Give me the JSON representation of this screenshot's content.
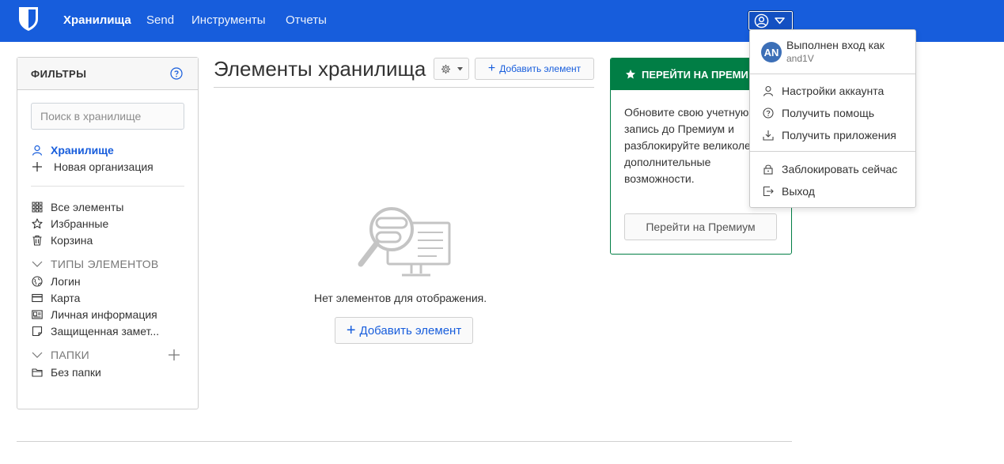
{
  "nav": {
    "links": [
      "Хранилища",
      "Send",
      "Инструменты",
      "Отчеты"
    ]
  },
  "filters": {
    "title": "ФИЛЬТРЫ",
    "search_placeholder": "Поиск в хранилище",
    "vault_label": "Хранилище",
    "new_org_label": "Новая организация",
    "all_items": "Все элементы",
    "favorites": "Избранные",
    "trash": "Корзина",
    "types_header": "ТИПЫ ЭЛЕМЕНТОВ",
    "types": [
      "Логин",
      "Карта",
      "Личная информация",
      "Защищенная замет..."
    ],
    "folders_header": "ПАПКИ",
    "no_folder": "Без папки"
  },
  "main": {
    "title": "Элементы хранилища",
    "add_item_top": "Добавить элемент",
    "empty_text": "Нет элементов для отображения.",
    "add_item_main": "Добавить элемент"
  },
  "premium": {
    "header": "ПЕРЕЙТИ НА ПРЕМИ",
    "body": "Обновите свою учетную запись до Премиум и разблокируйте великолепные дополнительные возможности.",
    "button": "Перейти на Премиум"
  },
  "account_menu": {
    "avatar_initials": "AN",
    "logged_in_as": "Выполнен вход как",
    "username": "and1V",
    "items": [
      "Настройки аккаунта",
      "Получить помощь",
      "Получить приложения"
    ],
    "lock": "Заблокировать сейчас",
    "logout": "Выход"
  },
  "colors": {
    "brand": "#175ddc",
    "premium_green": "#017e45",
    "avatar": "#3c6fb7"
  }
}
